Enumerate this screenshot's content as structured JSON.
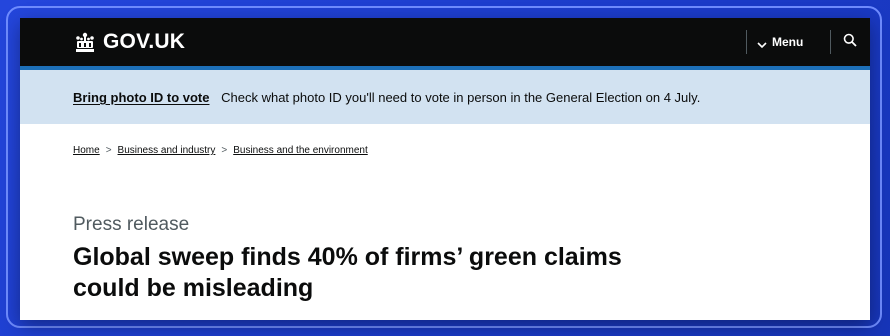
{
  "header": {
    "logo_text": "GOV.UK",
    "menu_label": "Menu",
    "icons": {
      "logo": "crown-icon",
      "menu": "chevron-down-icon",
      "search": "search-icon"
    }
  },
  "banner": {
    "link_text": "Bring photo ID to vote",
    "message": "Check what photo ID you'll need to vote in person in the General Election on 4 July."
  },
  "breadcrumb": {
    "items": [
      "Home",
      "Business and industry",
      "Business and the environment"
    ]
  },
  "content": {
    "caption": "Press release",
    "title": "Global sweep finds 40% of firms’ green claims could be misleading"
  },
  "colors": {
    "header_bg": "#0b0c0c",
    "accent_stripe": "#1d70b8",
    "banner_bg": "#d2e2f1",
    "page_bg": "#1d3fd6"
  }
}
